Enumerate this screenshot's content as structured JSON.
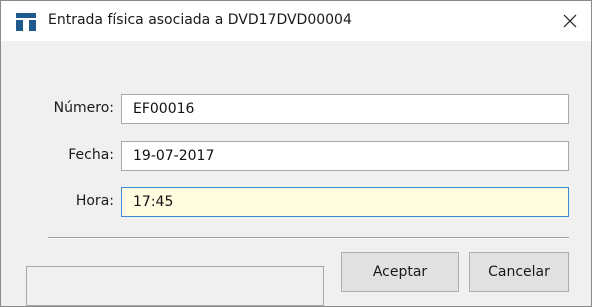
{
  "window": {
    "title": "Entrada física asociada a DVD17DVD00004",
    "app_icon": "app-logo-icon",
    "close_icon": "close-icon",
    "close_glyph": "✕"
  },
  "form": {
    "numero": {
      "label": "Número:",
      "value": "EF00016"
    },
    "fecha": {
      "label": "Fecha:",
      "value": "19-07-2017"
    },
    "hora": {
      "label": "Hora:",
      "value": "17:45"
    }
  },
  "buttons": {
    "accept_label": "Aceptar",
    "cancel_label": "Cancelar"
  },
  "colors": {
    "focused_input_bg": "#fffce0",
    "focused_input_border": "#3c8ad6",
    "app_icon": "#1e5a8c"
  }
}
